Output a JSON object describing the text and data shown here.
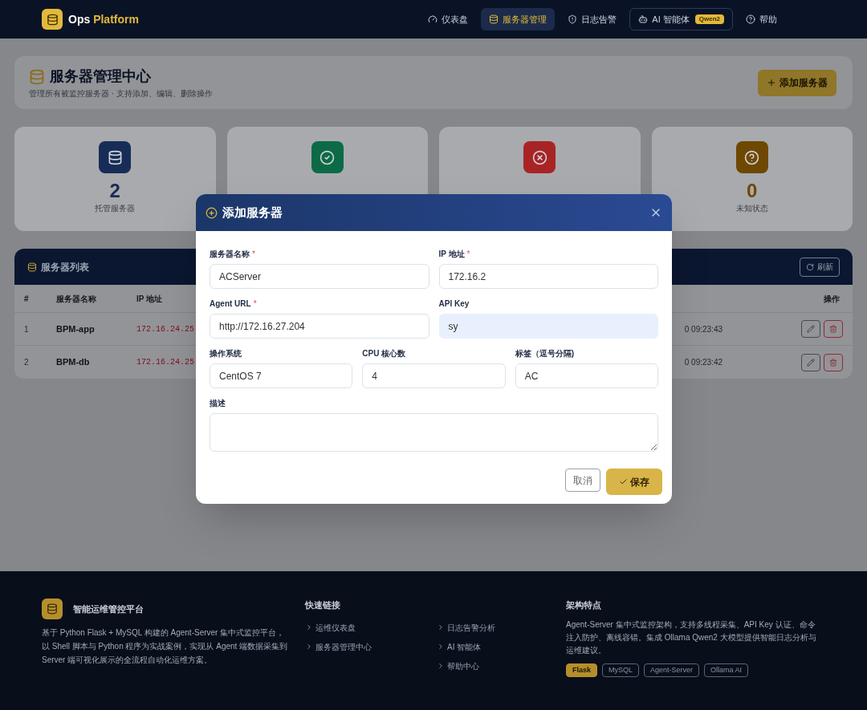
{
  "header": {
    "brand_main": "Ops",
    "brand_accent": "Platform",
    "nav": [
      {
        "label": "仪表盘",
        "selected": false,
        "kind": "link"
      },
      {
        "label": "服务器管理",
        "selected": true,
        "kind": "link"
      },
      {
        "label": "日志告警",
        "selected": false,
        "kind": "link"
      },
      {
        "label": "AI 智能体",
        "selected": false,
        "kind": "boxed",
        "badge": "Qwen2"
      },
      {
        "label": "帮助",
        "selected": false,
        "kind": "link"
      }
    ]
  },
  "page_header": {
    "title": "服务器管理中心",
    "subtitle": "管理所有被监控服务器 · 支持添加、编辑、删除操作",
    "add_button": "添加服务器"
  },
  "stats": [
    {
      "value": "2",
      "label": "托管服务器",
      "color": "#172d57"
    },
    {
      "color": "#0c6b46"
    },
    {
      "color": "#a82424"
    },
    {
      "value": "0",
      "label": "未知状态",
      "color": "#6e4800"
    }
  ],
  "server_list": {
    "title": "服务器列表",
    "refresh_button": "刷新",
    "columns": [
      "#",
      "服务器名称",
      "IP 地址",
      "操作"
    ],
    "rows": [
      {
        "index": "1",
        "name": "BPM-app",
        "ip": "172.16.24.25",
        "time": "0 09:23:43"
      },
      {
        "index": "2",
        "name": "BPM-db",
        "ip": "172.16.24.25",
        "time": "0 09:23:42"
      }
    ]
  },
  "modal": {
    "title": "添加服务器",
    "rows": [
      [
        {
          "label": "服务器名称",
          "required_mark": "*",
          "value": "ACServer",
          "kind": "text",
          "autofilled": false
        },
        {
          "label": "IP 地址",
          "required_mark": "*",
          "value": "172.16.2",
          "kind": "text",
          "autofilled": false
        }
      ],
      [
        {
          "label": "Agent URL",
          "required_mark": "*",
          "value": "http://172.16.27.204",
          "kind": "text",
          "autofilled": false
        },
        {
          "label": "API Key",
          "value": "sy",
          "kind": "text",
          "autofilled": true
        }
      ],
      [
        {
          "label": "操作系统",
          "value": "CentOS 7",
          "kind": "text",
          "autofilled": false
        },
        {
          "label": "CPU 核心数",
          "value": "4",
          "kind": "text",
          "autofilled": false
        },
        {
          "label": "标签（逗号分隔)",
          "value": "AC",
          "kind": "text",
          "autofilled": false
        }
      ],
      [
        {
          "label": "描述",
          "kind": "textarea"
        }
      ]
    ],
    "cancel_button": "取消",
    "save_button": "保存"
  },
  "footer": {
    "brand": "智能运维管控平台",
    "description": "基于 Python Flask + MySQL 构建的 Agent-Server 集中式监控平台，以 Shell 脚本与 Python 程序为实战案例，实现从 Agent 端数据采集到 Server 端可视化展示的全流程自动化运维方案。",
    "links_title": "快速链接",
    "links": [
      "运维仪表盘",
      "服务器管理中心",
      "日志告警分析",
      "AI 智能体",
      "帮助中心"
    ],
    "arch_title": "架构特点",
    "arch_text": "Agent-Server 集中式监控架构，支持多线程采集、API Key 认证、命令注入防护、离线容错。集成 Ollama Qwen2 大模型提供智能日志分析与运维建议。",
    "tags": [
      {
        "label": "Flask",
        "highlighted": true
      },
      {
        "label": "MySQL",
        "highlighted": false
      },
      {
        "label": "Agent-Server",
        "highlighted": false
      },
      {
        "label": "Ollama AI",
        "highlighted": false
      }
    ]
  }
}
